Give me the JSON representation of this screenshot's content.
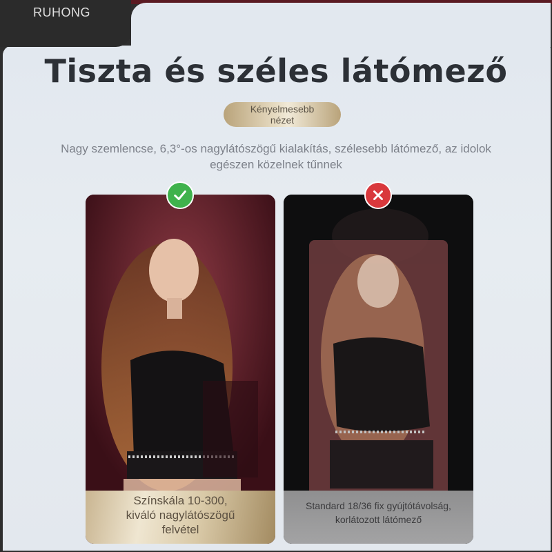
{
  "brand": {
    "name": "RUHONG"
  },
  "header": {
    "title": "Tiszta és széles látómező",
    "pill_line1": "Kényelmesebb",
    "pill_line2": "nézet",
    "subtitle_line1": "Nagy szemlencse, 6,3°-os nagylátószögű kialakítás, szélesebb látómező, az idolok",
    "subtitle_line2": "egészen közelnek tűnnek"
  },
  "comparison": {
    "good": {
      "icon": "check-icon",
      "badge_color": "#3fb24c",
      "caption_line1": "Színskála 10-300,",
      "caption_line2": "kiváló nagylátószögű",
      "caption_line3": "felvétel"
    },
    "bad": {
      "icon": "cross-icon",
      "badge_color": "#d9383c",
      "caption_line1": "Standard 18/36 fix gyújtótávolság,",
      "caption_line2": "korlátozott látómező"
    }
  },
  "colors": {
    "accent_gold": "#c9b591",
    "title_text": "#2c3036",
    "background": "#e4e9ef"
  }
}
